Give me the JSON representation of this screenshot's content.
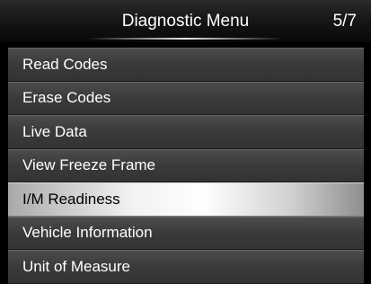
{
  "header": {
    "title": "Diagnostic Menu",
    "page_indicator": "5/7"
  },
  "menu": {
    "items": [
      {
        "label": "Read Codes",
        "selected": false
      },
      {
        "label": "Erase Codes",
        "selected": false
      },
      {
        "label": "Live Data",
        "selected": false
      },
      {
        "label": "View Freeze Frame",
        "selected": false
      },
      {
        "label": "I/M Readiness",
        "selected": true
      },
      {
        "label": "Vehicle Information",
        "selected": false
      },
      {
        "label": "Unit of Measure",
        "selected": false
      }
    ]
  },
  "colors": {
    "background": "#000000",
    "item_text": "#ffffff",
    "selected_text": "#000000",
    "selected_highlight": "#f2f2f2"
  }
}
